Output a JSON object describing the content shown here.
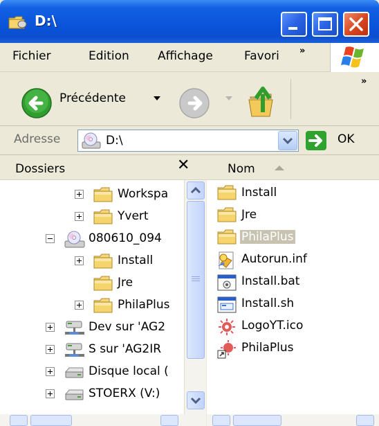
{
  "window": {
    "title": "D:\\"
  },
  "menu": {
    "items": [
      "Fichier",
      "Edition",
      "Affichage",
      "Favori"
    ],
    "more": "»"
  },
  "toolbar": {
    "back_label": "Précédente",
    "more": "»"
  },
  "address": {
    "label": "Adresse",
    "value": "D:\\",
    "go_label": "OK"
  },
  "folders": {
    "title": "Dossiers",
    "close": "✕",
    "tree": [
      {
        "label": "Workspa",
        "expander": "plus",
        "icon": "folder-icon"
      },
      {
        "label": "Yvert",
        "expander": "plus",
        "icon": "folder-icon"
      },
      {
        "label": "080610_094",
        "expander": "minus",
        "icon": "cd-drive-icon"
      },
      {
        "label": "Install",
        "expander": "plus",
        "icon": "folder-icon"
      },
      {
        "label": "Jre",
        "expander": "none",
        "icon": "folder-icon"
      },
      {
        "label": "PhilaPlus",
        "expander": "plus",
        "icon": "folder-icon"
      },
      {
        "label": "Dev sur 'AG2",
        "expander": "plus",
        "icon": "network-drive-icon"
      },
      {
        "label": "S sur 'AG2IR",
        "expander": "plus",
        "icon": "network-drive-icon"
      },
      {
        "label": "Disque local (",
        "expander": "plus",
        "icon": "hard-drive-icon"
      },
      {
        "label": "STOERX (V:)",
        "expander": "plus",
        "icon": "hard-drive-icon"
      }
    ]
  },
  "files": {
    "column_name": "Nom",
    "items": [
      {
        "label": "Install",
        "icon": "folder-icon",
        "selected": false
      },
      {
        "label": "Jre",
        "icon": "folder-icon",
        "selected": false
      },
      {
        "label": "PhilaPlus",
        "icon": "folder-icon",
        "selected": true
      },
      {
        "label": "Autorun.inf",
        "icon": "autorun-file-icon",
        "selected": false
      },
      {
        "label": "Install.bat",
        "icon": "batch-file-icon",
        "selected": false
      },
      {
        "label": "Install.sh",
        "icon": "script-file-icon",
        "selected": false
      },
      {
        "label": "LogoYT.ico",
        "icon": "ico-file-icon",
        "selected": false
      },
      {
        "label": "PhilaPlus",
        "icon": "shortcut-icon",
        "selected": false
      }
    ]
  },
  "colors": {
    "titlebar": "#0a54d9",
    "chrome": "#ece9d8",
    "selection": "#c8c3b0",
    "close_button": "#d5451e"
  }
}
